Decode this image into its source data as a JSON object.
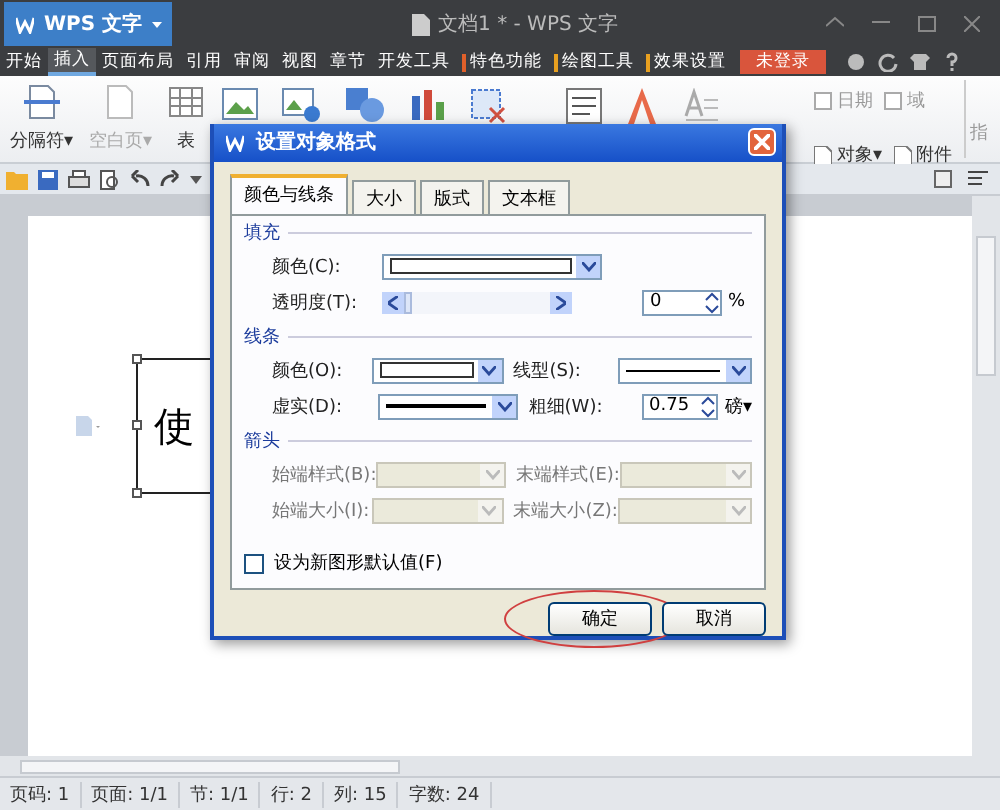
{
  "app": {
    "logo": "WPS 文字",
    "doc_title": "文档1 * - WPS 文字"
  },
  "menu": [
    {
      "label": "开始",
      "kind": "tab",
      "selected": false
    },
    {
      "label": "插入",
      "kind": "tab",
      "selected": true
    },
    {
      "label": "页面布局",
      "kind": "tab",
      "selected": false
    },
    {
      "label": "引用",
      "kind": "tab",
      "selected": false
    },
    {
      "label": "审阅",
      "kind": "tab",
      "selected": false
    },
    {
      "label": "视图",
      "kind": "tab",
      "selected": false
    },
    {
      "label": "章节",
      "kind": "tab",
      "selected": false
    },
    {
      "label": "开发工具",
      "kind": "tab",
      "selected": false
    },
    {
      "label": "特色功能",
      "kind": "context",
      "selected": false,
      "color": "#e0602a"
    },
    {
      "label": "绘图工具",
      "kind": "context",
      "selected": false,
      "color": "#e8a020"
    },
    {
      "label": "效果设置",
      "kind": "context",
      "selected": false,
      "color": "#e8a020"
    }
  ],
  "login": "未登录",
  "ribbon": {
    "left": [
      {
        "label": "分隔符▾",
        "disabled": false
      },
      {
        "label": "空白页▾",
        "disabled": true
      },
      {
        "label": "表",
        "disabled": false
      }
    ],
    "right": [
      {
        "label": "日期"
      },
      {
        "label": "域"
      },
      {
        "label": "对象▾"
      },
      {
        "label": "附件"
      }
    ],
    "cut": "指"
  },
  "document": {
    "text_box": "使"
  },
  "dialog": {
    "title": "设置对象格式",
    "tabs": [
      {
        "label": "颜色与线条",
        "selected": true
      },
      {
        "label": "大小",
        "selected": false
      },
      {
        "label": "版式",
        "selected": false
      },
      {
        "label": "文本框",
        "selected": false
      }
    ],
    "fill": {
      "heading": "填充",
      "color_label": "颜色(C):",
      "transparency_label": "透明度(T):",
      "level": 0,
      "transparency_value": "0",
      "unit": "%"
    },
    "line": {
      "heading": "线条",
      "color_label": "颜色(O):",
      "style_label": "线型(S):",
      "dash_label": "虚实(D):",
      "weight_label": "粗细(W):",
      "weight_value": "0.75",
      "weight_unit": "磅▾"
    },
    "arrows": {
      "heading": "箭头",
      "fields": [
        {
          "label": "始端样式(B):",
          "disabled": true
        },
        {
          "label": "末端样式(E):",
          "disabled": true
        },
        {
          "label": "始端大小(I):",
          "disabled": true
        },
        {
          "label": "末端大小(Z):",
          "disabled": true
        }
      ]
    },
    "default_checkbox": {
      "label": "设为新图形默认值(F)",
      "checked": false
    },
    "buttons": [
      {
        "label": "确定",
        "highlighted": true
      },
      {
        "label": "取消",
        "highlighted": false
      }
    ]
  },
  "status_bar": [
    "页码: 1",
    "页面: 1/1",
    "节: 1/1",
    "行: 2",
    "列: 15",
    "字数: 24"
  ]
}
